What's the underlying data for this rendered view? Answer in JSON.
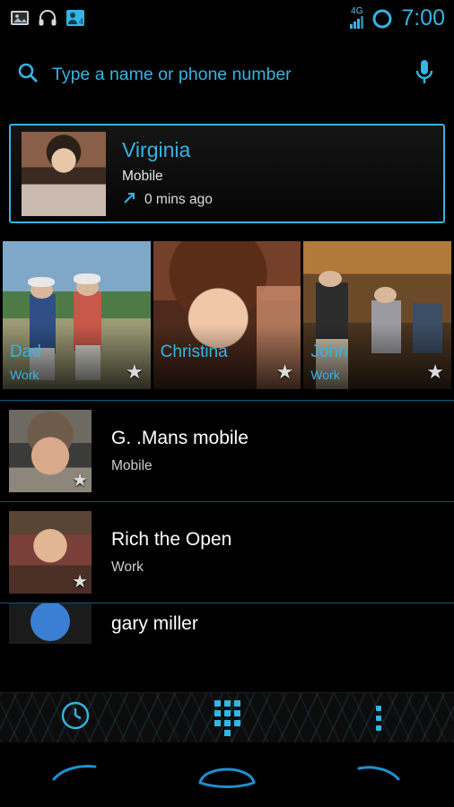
{
  "statusbar": {
    "icons": [
      "gallery-icon",
      "headphones-icon",
      "contacts-sync-icon"
    ],
    "network_label": "4G",
    "signal_bars": 4,
    "signal_active": 3,
    "clock": "7:00",
    "accent": "#33b5e5"
  },
  "search": {
    "placeholder": "Type a name or phone number",
    "icon": "search-icon",
    "voice_icon": "microphone-icon"
  },
  "highlight_contact": {
    "name": "Virginia",
    "type": "Mobile",
    "call_direction_icon": "outgoing-call-arrow-icon",
    "time": "0 mins ago",
    "avatar": "virginia-photo"
  },
  "favorites": [
    {
      "name": "Dad",
      "type": "Work",
      "starred": true,
      "avatar": "dad-photo"
    },
    {
      "name": "Christina",
      "type": "",
      "starred": true,
      "avatar": "christina-photo"
    },
    {
      "name": "John",
      "type": "Work",
      "starred": true,
      "avatar": "john-photo"
    }
  ],
  "contacts": [
    {
      "name": "G. .Mans mobile",
      "type": "Mobile",
      "starred": true,
      "avatar": "gmans-photo"
    },
    {
      "name": "Rich the Open",
      "type": "Work",
      "starred": true,
      "avatar": "rich-photo"
    },
    {
      "name": "gary miller",
      "type": "",
      "starred": false,
      "avatar": "default-avatar"
    }
  ],
  "tabs": [
    {
      "label": "",
      "icon": "recent-calls-clock-icon",
      "selected": false
    },
    {
      "label": "",
      "icon": "dialpad-icon",
      "selected": false
    },
    {
      "label": "",
      "icon": "overflow-menu-icon",
      "selected": false
    }
  ],
  "navbar": [
    {
      "icon": "back-icon"
    },
    {
      "icon": "home-icon"
    },
    {
      "icon": "recents-icon"
    }
  ]
}
